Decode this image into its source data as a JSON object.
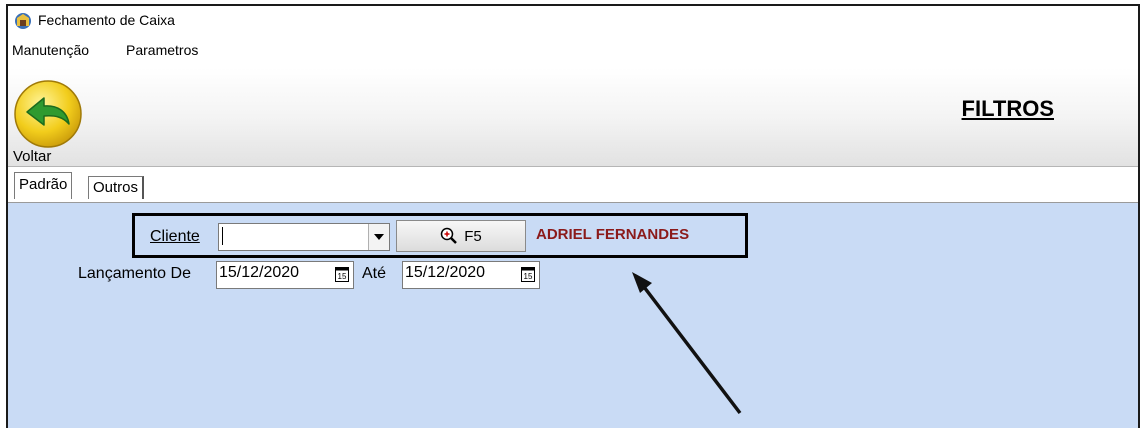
{
  "window": {
    "title": "Fechamento de Caixa"
  },
  "menu": {
    "items": [
      "Manutenção",
      "Parametros"
    ]
  },
  "toolbar": {
    "back_label": "Voltar",
    "heading": "FILTROS"
  },
  "tabs": [
    {
      "label": "Padrão",
      "active": true
    },
    {
      "label": "Outros",
      "active": false
    }
  ],
  "filters": {
    "cliente_label": "Cliente",
    "cliente_value": "",
    "search_button_label": "F5",
    "client_name": "ADRIEL FERNANDES",
    "lancamento_label": "Lançamento De",
    "date_from": "15/12/2020",
    "ate_label": "Até",
    "date_to": "15/12/2020"
  },
  "colors": {
    "panel_bg": "#c9dbf5",
    "client_name": "#8b1a1a",
    "back_icon": "#f2cd1c",
    "back_arrow": "#2f9a2f"
  }
}
